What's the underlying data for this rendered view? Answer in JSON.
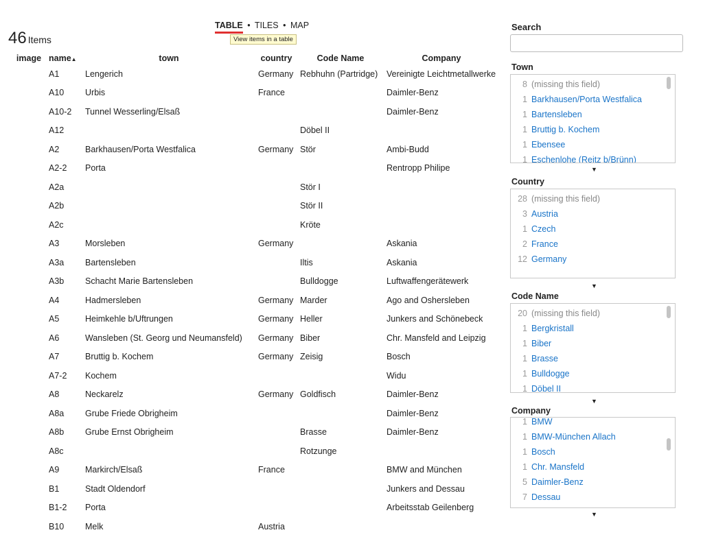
{
  "header": {
    "count": "46",
    "count_label": "Items",
    "views": [
      "TABLE",
      "TILES",
      "MAP"
    ],
    "separator": "•",
    "tooltip": "View items in a table"
  },
  "table": {
    "columns": [
      "image",
      "name",
      "town",
      "country",
      "Code Name",
      "Company"
    ],
    "sort_indicator": "▲",
    "rows": [
      {
        "name": "A1",
        "town": "Lengerich",
        "country": "Germany",
        "code": "Rebhuhn (Partridge)",
        "company": "Vereinigte Leichtmetallwerke"
      },
      {
        "name": "A10",
        "town": "Urbis",
        "country": "France",
        "code": "",
        "company": "Daimler-Benz"
      },
      {
        "name": "A10-2",
        "town": "Tunnel Wesserling/Elsaß",
        "country": "",
        "code": "",
        "company": "Daimler-Benz"
      },
      {
        "name": "A12",
        "town": "",
        "country": "",
        "code": "Döbel II",
        "company": ""
      },
      {
        "name": "A2",
        "town": "Barkhausen/Porta Westfalica",
        "country": "Germany",
        "code": "Stör",
        "company": "Ambi-Budd"
      },
      {
        "name": "A2-2",
        "town": "Porta",
        "country": "",
        "code": "",
        "company": "Rentropp Philipe"
      },
      {
        "name": "A2a",
        "town": "",
        "country": "",
        "code": "Stör I",
        "company": ""
      },
      {
        "name": "A2b",
        "town": "",
        "country": "",
        "code": "Stör II",
        "company": ""
      },
      {
        "name": "A2c",
        "town": "",
        "country": "",
        "code": "Kröte",
        "company": ""
      },
      {
        "name": "A3",
        "town": "Morsleben",
        "country": "Germany",
        "code": "",
        "company": "Askania"
      },
      {
        "name": "A3a",
        "town": "Bartensleben",
        "country": "",
        "code": "Iltis",
        "company": "Askania"
      },
      {
        "name": "A3b",
        "town": "Schacht Marie Bartensleben",
        "country": "",
        "code": "Bulldogge",
        "company": "Luftwaffengerätewerk"
      },
      {
        "name": "A4",
        "town": "Hadmersleben",
        "country": "Germany",
        "code": "Marder",
        "company": "Ago and Oshersleben"
      },
      {
        "name": "A5",
        "town": "Heimkehle b/Uftrungen",
        "country": "Germany",
        "code": "Heller",
        "company": "Junkers and Schönebeck"
      },
      {
        "name": "A6",
        "town": "Wansleben (St. Georg und Neumansfeld)",
        "country": "Germany",
        "code": "Biber",
        "company": "Chr. Mansfeld and Leipzig"
      },
      {
        "name": "A7",
        "town": "Bruttig b. Kochem",
        "country": "Germany",
        "code": "Zeisig",
        "company": "Bosch"
      },
      {
        "name": "A7-2",
        "town": "Kochem",
        "country": "",
        "code": "",
        "company": "Widu"
      },
      {
        "name": "A8",
        "town": "Neckarelz",
        "country": "Germany",
        "code": "Goldfisch",
        "company": "Daimler-Benz"
      },
      {
        "name": "A8a",
        "town": "Grube Friede Obrigheim",
        "country": "",
        "code": "",
        "company": "Daimler-Benz"
      },
      {
        "name": "A8b",
        "town": "Grube Ernst Obrigheim",
        "country": "",
        "code": "Brasse",
        "company": "Daimler-Benz"
      },
      {
        "name": "A8c",
        "town": "",
        "country": "",
        "code": "Rotzunge",
        "company": ""
      },
      {
        "name": "A9",
        "town": "Markirch/Elsaß",
        "country": "France",
        "code": "",
        "company": "BMW and München"
      },
      {
        "name": "B1",
        "town": "Stadt Oldendorf",
        "country": "",
        "code": "",
        "company": "Junkers and Dessau"
      },
      {
        "name": "B1-2",
        "town": "Porta",
        "country": "",
        "code": "",
        "company": "Arbeitsstab Geilenberg"
      },
      {
        "name": "B10",
        "town": "Melk",
        "country": "Austria",
        "code": "",
        "company": ""
      }
    ]
  },
  "search": {
    "title": "Search",
    "value": "",
    "placeholder": ""
  },
  "facets": {
    "town": {
      "title": "Town",
      "items": [
        {
          "n": "8",
          "t": "(missing this field)",
          "missing": true
        },
        {
          "n": "1",
          "t": "Barkhausen/Porta Westfalica"
        },
        {
          "n": "1",
          "t": "Bartensleben"
        },
        {
          "n": "1",
          "t": "Bruttig b. Kochem"
        },
        {
          "n": "1",
          "t": "Ebensee"
        },
        {
          "n": "1",
          "t": "Eschenlohe (Reitz b/Brünn)"
        }
      ]
    },
    "country": {
      "title": "Country",
      "items": [
        {
          "n": "28",
          "t": "(missing this field)",
          "missing": true
        },
        {
          "n": "3",
          "t": "Austria"
        },
        {
          "n": "1",
          "t": "Czech"
        },
        {
          "n": "2",
          "t": "France"
        },
        {
          "n": "12",
          "t": "Germany"
        }
      ]
    },
    "code": {
      "title": "Code Name",
      "items": [
        {
          "n": "20",
          "t": "(missing this field)",
          "missing": true
        },
        {
          "n": "1",
          "t": "Bergkristall"
        },
        {
          "n": "1",
          "t": "Biber"
        },
        {
          "n": "1",
          "t": "Brasse"
        },
        {
          "n": "1",
          "t": "Bulldogge"
        },
        {
          "n": "1",
          "t": "Döbel II"
        }
      ]
    },
    "company": {
      "title": "Company",
      "items": [
        {
          "n": "1",
          "t": "BMW"
        },
        {
          "n": "1",
          "t": "BMW-München Allach"
        },
        {
          "n": "1",
          "t": "Bosch"
        },
        {
          "n": "1",
          "t": "Chr. Mansfeld"
        },
        {
          "n": "5",
          "t": "Daimler-Benz"
        },
        {
          "n": "7",
          "t": "Dessau"
        }
      ]
    }
  },
  "more_icon": "▼",
  "colors": {
    "link": "#1a74c8",
    "active_underline": "#e03030",
    "tooltip_bg": "#fffbd0"
  }
}
